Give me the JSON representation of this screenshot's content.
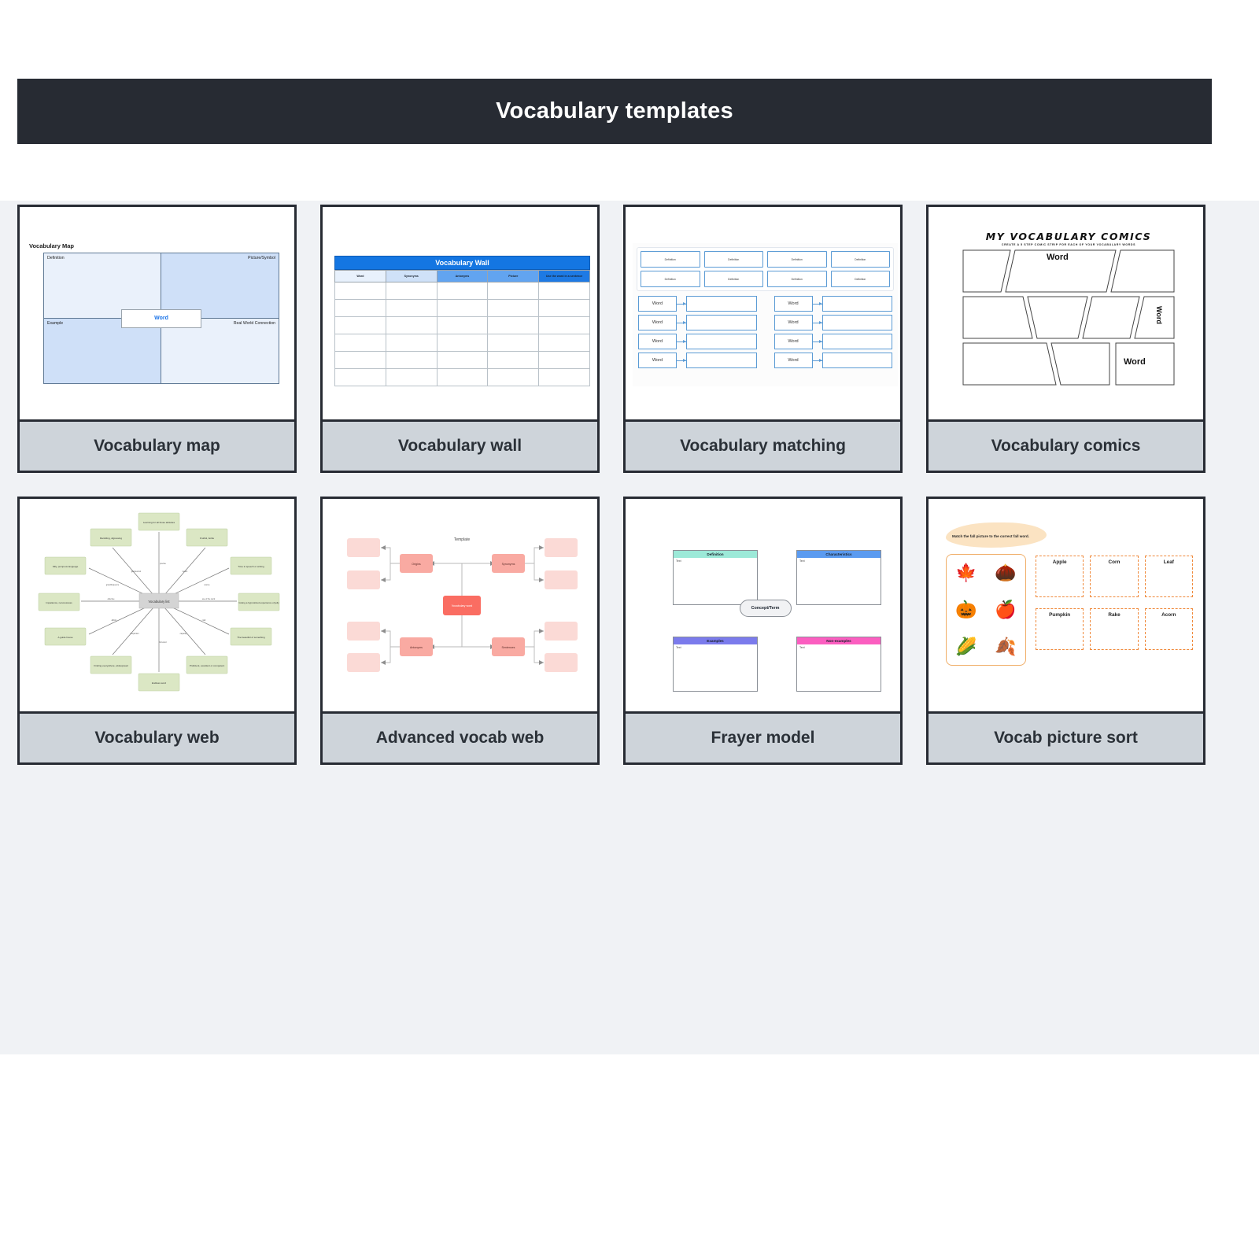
{
  "header": {
    "title": "Vocabulary templates"
  },
  "cards": [
    {
      "caption": "Vocabulary map"
    },
    {
      "caption": "Vocabulary wall"
    },
    {
      "caption": "Vocabulary matching"
    },
    {
      "caption": "Vocabulary comics"
    },
    {
      "caption": "Vocabulary web"
    },
    {
      "caption": "Advanced vocab web"
    },
    {
      "caption": "Frayer model"
    },
    {
      "caption": "Vocab picture sort"
    }
  ],
  "vocabulary_map": {
    "title": "Vocabulary Map",
    "quadrants": [
      "Definition",
      "Picture/Symbol",
      "Example",
      "Real World Connection"
    ],
    "center": "Word",
    "colors": {
      "light": "#eaf1fb",
      "dark": "#cfe0f8",
      "center_text": "#1a73e8"
    }
  },
  "vocabulary_wall": {
    "title": "Vocabulary Wall",
    "columns": [
      "Word",
      "Synonyms",
      "Antonyms",
      "Picture",
      "Use the word in a sentence"
    ],
    "rows": 6,
    "colors": {
      "header": "#1476e2"
    }
  },
  "vocabulary_matching": {
    "definition_label": "Definition",
    "definition_count": 8,
    "word_label": "Word",
    "pair_count": 8,
    "colors": {
      "border": "#5b9bd5"
    }
  },
  "vocabulary_comics": {
    "title": "MY VOCABULARY COMICS",
    "subtitle": "CREATE A 5 STEP COMIC STRIP FOR EACH OF YOUR VOCABULARY WORDS",
    "panel_words": [
      "Word",
      "Word",
      "Word"
    ]
  },
  "vocabulary_web": {
    "center": "Vocabulary list",
    "nodes": [
      "Learning for all those attitudes",
      "Fruitful, fertile",
      "Time in speech or writing",
      "Giving a hypnotized experience of jelly",
      "The beautiful of something",
      "Proficient, excellent or competent",
      "Endless word",
      "Finding everywhere, widespread",
      "A guide house",
      "Impatience, nervousness",
      "Silly, pompous language",
      "Rambling, digressing"
    ],
    "edge_labels": [
      "precise",
      "lucent",
      "source",
      "use of the word",
      "craft",
      "capacity",
      "full word",
      "skepticism",
      "affinity",
      "effective",
      "grandiloquence",
      "glorious/not"
    ],
    "colors": {
      "node": "#dbe7c4",
      "center": "#d4d4d4"
    }
  },
  "advanced_vocab_web": {
    "title": "Template",
    "center": "Vocabulary word",
    "branches": [
      "Origins",
      "Synonyms",
      "Antonyms",
      "Sentences"
    ],
    "leaves_per_branch": 2,
    "colors": {
      "center": "#fa6d62",
      "branch": "#f9aaa2",
      "leaf": "#fbdad6"
    }
  },
  "frayer_model": {
    "quadrants": [
      {
        "label": "Definition",
        "color": "#9ce9d8",
        "body": "Text"
      },
      {
        "label": "Characteristics",
        "color": "#5b9bf0",
        "body": "Text"
      },
      {
        "label": "Examples",
        "color": "#7b7bec",
        "body": "Text"
      },
      {
        "label": "Non-examples",
        "color": "#fb5ec0",
        "body": "Text"
      }
    ],
    "center": "Concept/Term"
  },
  "vocab_picture_sort": {
    "instruction": "Match the fall picture to the correct fall word.",
    "pictures": [
      "🍁",
      "🌰",
      "🎃",
      "🍎",
      "🌽",
      "🍂"
    ],
    "words": [
      "Apple",
      "Corn",
      "Leaf",
      "Pumpkin",
      "Rake",
      "Acorn"
    ],
    "colors": {
      "accent": "#f08a3c",
      "blob": "#fbe3c2"
    }
  }
}
